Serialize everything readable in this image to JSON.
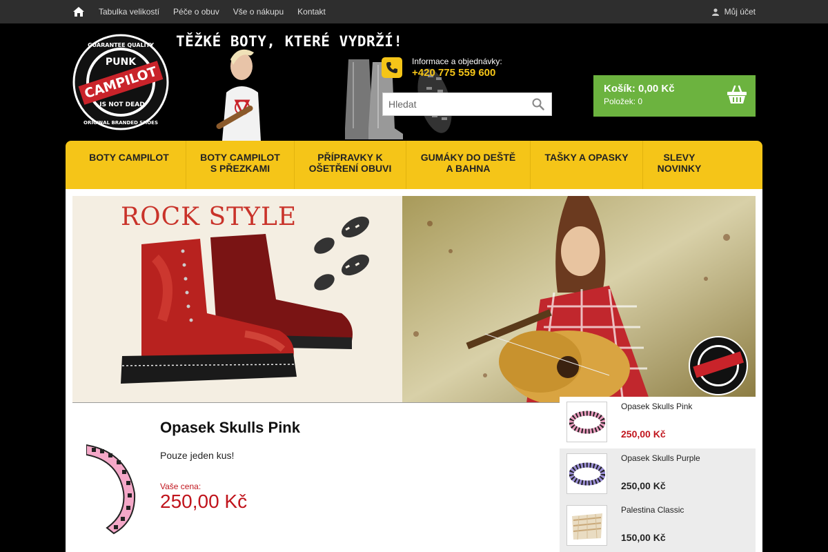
{
  "topbar": {
    "links": [
      "Tabulka velikostí",
      "Péče o obuv",
      "Vše o nákupu",
      "Kontakt"
    ],
    "account_label": "Můj účet"
  },
  "header": {
    "logo_texts": [
      "GUARANTEE QUALITY",
      "PUNK",
      "CAMPILOT",
      "IS NOT DEAD",
      "ORIGINAL BRANDED SHOES"
    ],
    "tagline": "TĚŽKÉ BOTY, KTERÉ VYDRŽÍ!",
    "contact_label": "Informace a objednávky:",
    "phone": "+420 775 559 600",
    "search_placeholder": "Hledat",
    "cart_title": "Košík: 0,00 Kč",
    "cart_items": "Položek: 0"
  },
  "nav": {
    "items": [
      {
        "line1": "BOTY CAMPILOT",
        "line2": ""
      },
      {
        "line1": "BOTY CAMPILOT",
        "line2": "S PŘEZKAMI"
      },
      {
        "line1": "PŘÍPRAVKY K",
        "line2": "OŠETŘENÍ OBUVI"
      },
      {
        "line1": "GUMÁKY DO DEŠTĚ",
        "line2": "A BAHNA"
      },
      {
        "line1": "TAŠKY A OPASKY",
        "line2": ""
      },
      {
        "line1": "SLEVY",
        "line2": "NOVINKY"
      }
    ]
  },
  "hero": {
    "title": "ROCK STYLE"
  },
  "product": {
    "title": "Opasek Skulls Pink",
    "availability": "Pouze jeden kus!",
    "price_label": "Vaše cena:",
    "price": "250,00 Kč"
  },
  "related": [
    {
      "name": "Opasek Skulls Pink",
      "price": "250,00 Kč"
    },
    {
      "name": "Opasek Skulls Purple",
      "price": "250,00 Kč"
    },
    {
      "name": "Palestina Classic",
      "price": "150,00 Kč"
    }
  ],
  "colors": {
    "accent_yellow": "#f5c518",
    "cart_green": "#6cb33f",
    "price_red": "#c0141c",
    "topbar": "#2e2e2e"
  }
}
